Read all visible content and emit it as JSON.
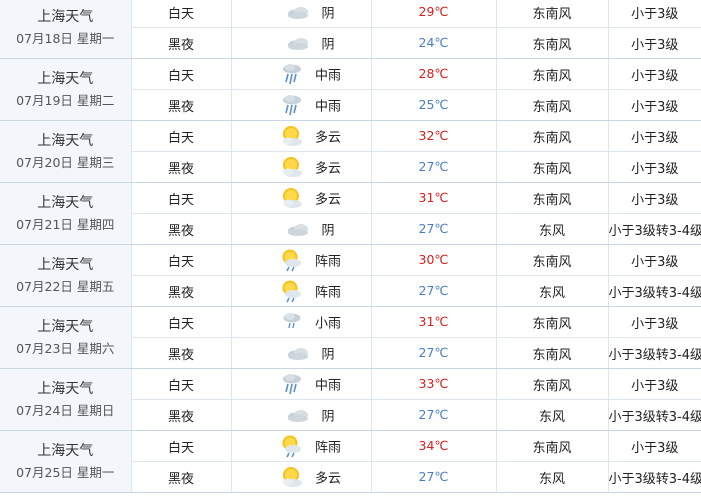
{
  "colors": {
    "temp_day": "#d4201c",
    "temp_night": "#4a7fc1",
    "cloud": "#c5d0d8",
    "sun": "#f5c21b",
    "rain": "#5a8fc8"
  },
  "days": [
    {
      "city": "上海天气",
      "date": "07月18日 星期一",
      "day": {
        "period": "白天",
        "icon": "overcast-icon",
        "condition": "阴",
        "temp": "29℃",
        "wind_dir": "东南风",
        "wind_level": "小于3级"
      },
      "night": {
        "period": "黑夜",
        "icon": "overcast-icon",
        "condition": "阴",
        "temp": "24℃",
        "wind_dir": "东南风",
        "wind_level": "小于3级"
      }
    },
    {
      "city": "上海天气",
      "date": "07月19日 星期二",
      "day": {
        "period": "白天",
        "icon": "moderate-rain-icon",
        "condition": "中雨",
        "temp": "28℃",
        "wind_dir": "东南风",
        "wind_level": "小于3级"
      },
      "night": {
        "period": "黑夜",
        "icon": "moderate-rain-icon",
        "condition": "中雨",
        "temp": "25℃",
        "wind_dir": "东南风",
        "wind_level": "小于3级"
      }
    },
    {
      "city": "上海天气",
      "date": "07月20日 星期三",
      "day": {
        "period": "白天",
        "icon": "partly-cloudy-icon",
        "condition": "多云",
        "temp": "32℃",
        "wind_dir": "东南风",
        "wind_level": "小于3级"
      },
      "night": {
        "period": "黑夜",
        "icon": "partly-cloudy-icon",
        "condition": "多云",
        "temp": "27℃",
        "wind_dir": "东南风",
        "wind_level": "小于3级"
      }
    },
    {
      "city": "上海天气",
      "date": "07月21日 星期四",
      "day": {
        "period": "白天",
        "icon": "partly-cloudy-icon",
        "condition": "多云",
        "temp": "31℃",
        "wind_dir": "东南风",
        "wind_level": "小于3级"
      },
      "night": {
        "period": "黑夜",
        "icon": "overcast-icon",
        "condition": "阴",
        "temp": "27℃",
        "wind_dir": "东风",
        "wind_level": "小于3级转3-4级"
      }
    },
    {
      "city": "上海天气",
      "date": "07月22日 星期五",
      "day": {
        "period": "白天",
        "icon": "shower-icon",
        "condition": "阵雨",
        "temp": "30℃",
        "wind_dir": "东南风",
        "wind_level": "小于3级"
      },
      "night": {
        "period": "黑夜",
        "icon": "shower-icon",
        "condition": "阵雨",
        "temp": "27℃",
        "wind_dir": "东风",
        "wind_level": "小于3级转3-4级"
      }
    },
    {
      "city": "上海天气",
      "date": "07月23日 星期六",
      "day": {
        "period": "白天",
        "icon": "light-rain-icon",
        "condition": "小雨",
        "temp": "31℃",
        "wind_dir": "东南风",
        "wind_level": "小于3级"
      },
      "night": {
        "period": "黑夜",
        "icon": "overcast-icon",
        "condition": "阴",
        "temp": "27℃",
        "wind_dir": "东南风",
        "wind_level": "小于3级转3-4级"
      }
    },
    {
      "city": "上海天气",
      "date": "07月24日 星期日",
      "day": {
        "period": "白天",
        "icon": "moderate-rain-icon",
        "condition": "中雨",
        "temp": "33℃",
        "wind_dir": "东南风",
        "wind_level": "小于3级"
      },
      "night": {
        "period": "黑夜",
        "icon": "overcast-icon",
        "condition": "阴",
        "temp": "27℃",
        "wind_dir": "东风",
        "wind_level": "小于3级转3-4级"
      }
    },
    {
      "city": "上海天气",
      "date": "07月25日 星期一",
      "day": {
        "period": "白天",
        "icon": "shower-icon",
        "condition": "阵雨",
        "temp": "34℃",
        "wind_dir": "东南风",
        "wind_level": "小于3级"
      },
      "night": {
        "period": "黑夜",
        "icon": "partly-cloudy-icon",
        "condition": "多云",
        "temp": "27℃",
        "wind_dir": "东风",
        "wind_level": "小于3级转3-4级"
      }
    }
  ]
}
